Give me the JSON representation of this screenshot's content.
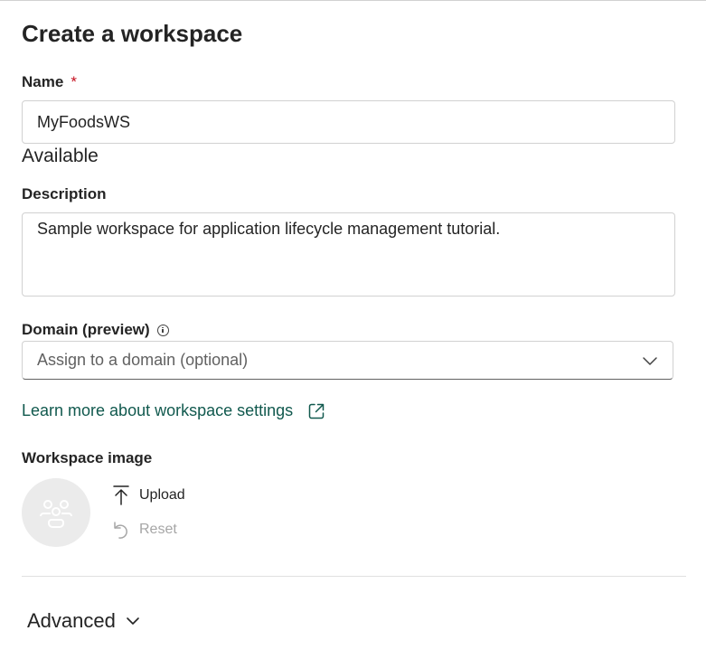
{
  "form": {
    "title": "Create a workspace",
    "name": {
      "label": "Name",
      "required_mark": "*",
      "value": "MyFoodsWS",
      "availability": "Available"
    },
    "description": {
      "label": "Description",
      "value": "Sample workspace for application lifecycle management tutorial."
    },
    "domain": {
      "label": "Domain (preview)",
      "placeholder": "Assign to a domain (optional)"
    },
    "learn_more": {
      "text": "Learn more about workspace settings"
    },
    "workspace_image": {
      "label": "Workspace image",
      "upload_label": "Upload",
      "reset_label": "Reset"
    },
    "advanced": {
      "label": "Advanced"
    }
  },
  "colors": {
    "link": "#11594e",
    "required": "#c50f1f",
    "disabled": "#a6a6a6"
  },
  "icons": [
    "info-icon",
    "chevron-down-icon",
    "external-link-icon",
    "people-group-icon",
    "upload-arrow-icon",
    "reset-undo-icon"
  ]
}
